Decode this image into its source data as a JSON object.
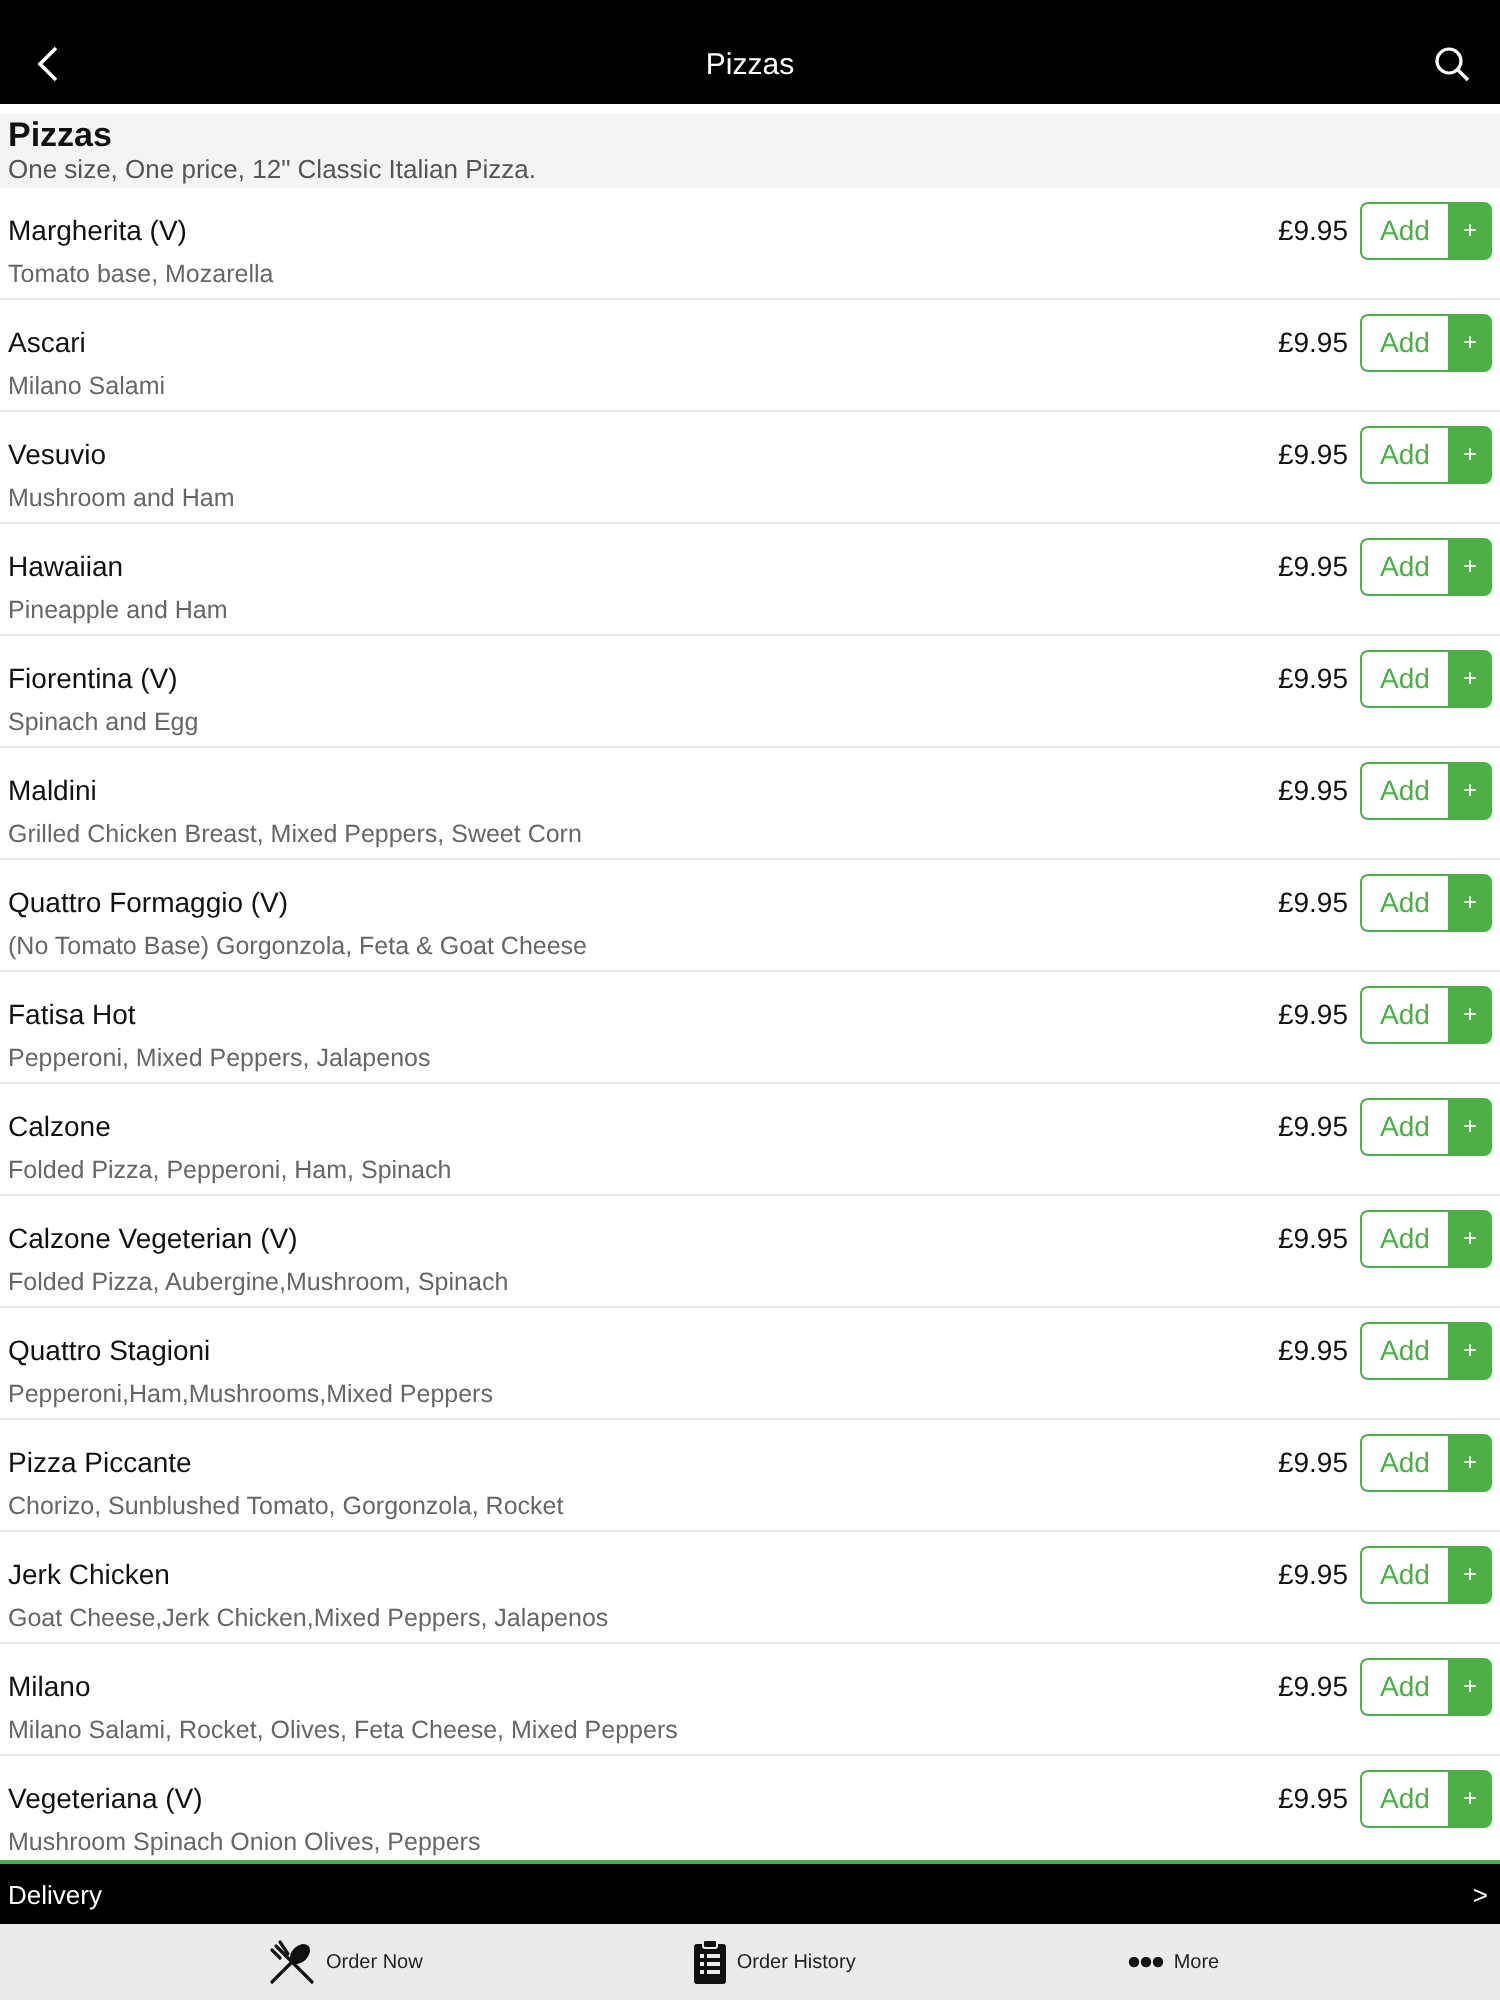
{
  "header": {
    "title": "Pizzas"
  },
  "section": {
    "title": "Pizzas",
    "subtitle": "One size, One price, 12\" Classic Italian Pizza."
  },
  "items": [
    {
      "name": "Margherita (V)",
      "description": "Tomato base, Mozarella",
      "price": "£9.95",
      "add": "Add",
      "plus": "+"
    },
    {
      "name": "Ascari",
      "description": "Milano Salami",
      "price": "£9.95",
      "add": "Add",
      "plus": "+"
    },
    {
      "name": "Vesuvio",
      "description": "Mushroom and Ham",
      "price": "£9.95",
      "add": "Add",
      "plus": "+"
    },
    {
      "name": "Hawaiian",
      "description": "Pineapple and Ham",
      "price": "£9.95",
      "add": "Add",
      "plus": "+"
    },
    {
      "name": "Fiorentina (V)",
      "description": "Spinach and Egg",
      "price": "£9.95",
      "add": "Add",
      "plus": "+"
    },
    {
      "name": "Maldini",
      "description": "Grilled Chicken Breast, Mixed Peppers, Sweet Corn",
      "price": "£9.95",
      "add": "Add",
      "plus": "+"
    },
    {
      "name": "Quattro Formaggio (V)",
      "description": "(No Tomato Base) Gorgonzola, Feta & Goat Cheese",
      "price": "£9.95",
      "add": "Add",
      "plus": "+"
    },
    {
      "name": "Fatisa Hot",
      "description": "Pepperoni, Mixed Peppers, Jalapenos",
      "price": "£9.95",
      "add": "Add",
      "plus": "+"
    },
    {
      "name": "Calzone",
      "description": "Folded Pizza, Pepperoni, Ham, Spinach",
      "price": "£9.95",
      "add": "Add",
      "plus": "+"
    },
    {
      "name": "Calzone Vegeterian (V)",
      "description": "Folded Pizza, Aubergine,Mushroom, Spinach",
      "price": "£9.95",
      "add": "Add",
      "plus": "+"
    },
    {
      "name": "Quattro Stagioni",
      "description": "Pepperoni,Ham,Mushrooms,Mixed Peppers",
      "price": "£9.95",
      "add": "Add",
      "plus": "+"
    },
    {
      "name": "Pizza Piccante",
      "description": "Chorizo, Sunblushed Tomato, Gorgonzola, Rocket",
      "price": "£9.95",
      "add": "Add",
      "plus": "+"
    },
    {
      "name": "Jerk Chicken",
      "description": "Goat Cheese,Jerk Chicken,Mixed Peppers, Jalapenos",
      "price": "£9.95",
      "add": "Add",
      "plus": "+"
    },
    {
      "name": "Milano",
      "description": "Milano Salami, Rocket, Olives, Feta Cheese, Mixed Peppers",
      "price": "£9.95",
      "add": "Add",
      "plus": "+"
    },
    {
      "name": "Vegeteriana (V)",
      "description": "Mushroom Spinach Onion Olives, Peppers",
      "price": "£9.95",
      "add": "Add",
      "plus": "+"
    }
  ],
  "delivery_bar": {
    "label": "Delivery",
    "arrow": ">"
  },
  "tab_bar": [
    {
      "kind": "order",
      "label": "Order Now"
    },
    {
      "kind": "history",
      "label": "Order History"
    },
    {
      "kind": "more",
      "label": "More"
    }
  ]
}
